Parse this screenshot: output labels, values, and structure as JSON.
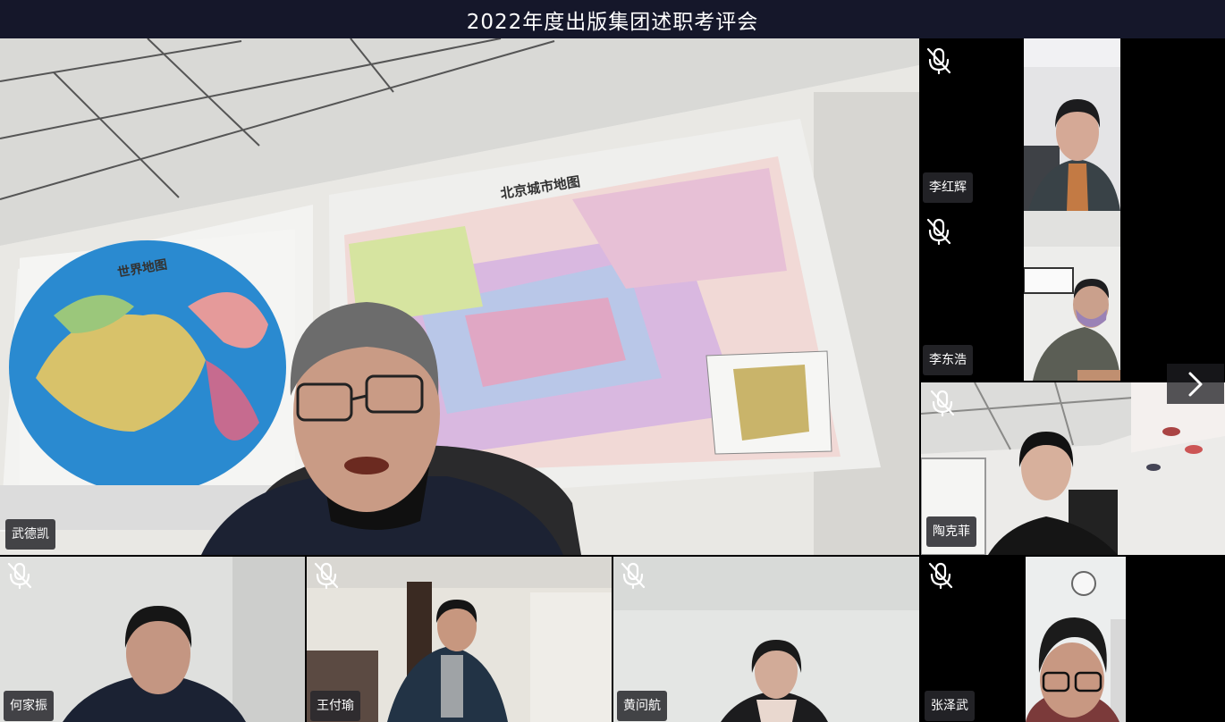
{
  "meeting": {
    "title": "2022年度出版集团述职考评会"
  },
  "main_speaker": {
    "name": "武德凯"
  },
  "side_participants": [
    {
      "name": "李红辉",
      "muted": true
    },
    {
      "name": "李东浩",
      "muted": true
    },
    {
      "name": "陶克菲",
      "muted": true
    }
  ],
  "bottom_participants": [
    {
      "name": "何家振",
      "muted": true
    },
    {
      "name": "王付瑜",
      "muted": true
    },
    {
      "name": "黄问航",
      "muted": true
    },
    {
      "name": "张泽武",
      "muted": true
    }
  ],
  "main_video_text": {
    "world_map_title": "世界地图",
    "city_map_title": "北京城市地图"
  },
  "icons": {
    "mute": "mic-off-icon",
    "next": "chevron-right-icon"
  }
}
